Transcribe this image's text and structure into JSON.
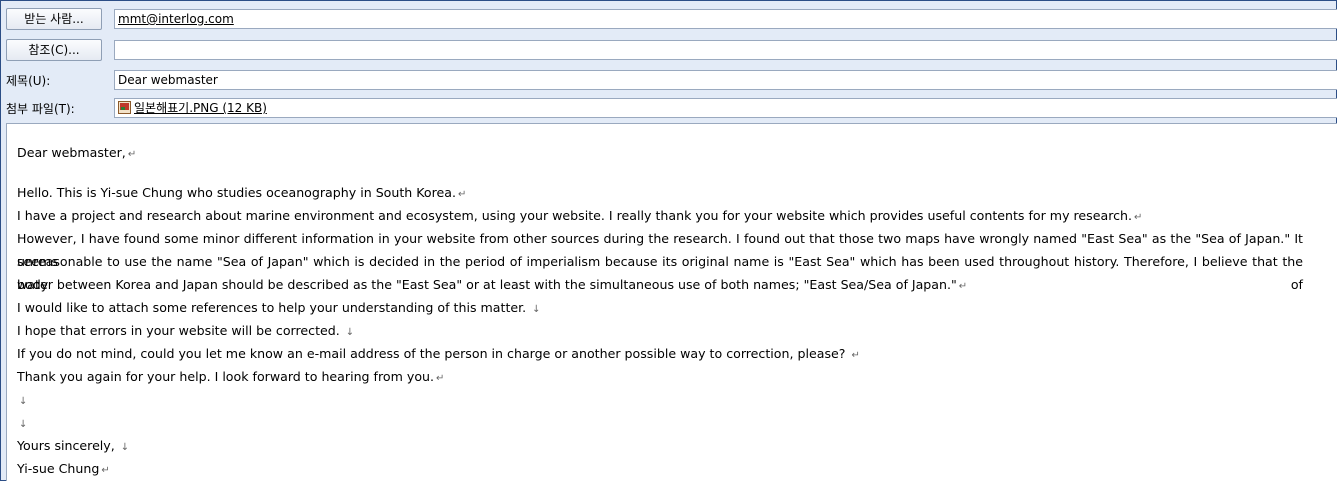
{
  "header": {
    "to_button": "받는 사람...",
    "to_value": "mmt@interlog.com",
    "cc_button": "참조(C)...",
    "cc_value": "",
    "subject_label": "제목(U):",
    "subject_value": "Dear webmaster",
    "attach_label": "첨부 파일(T):",
    "attach_name": "일본해표기.PNG (12 KB)"
  },
  "body": {
    "greeting": "Dear webmaster,",
    "line1": "Hello. This is Yi-sue Chung who studies oceanography in South Korea.",
    "line2": "I have a project and research about marine environment and ecosystem, using your website. I really thank you for your website which provides useful contents for my research.",
    "line3a": "However, I have found some minor different information in your website from other sources during the research. I found out that those two maps have wrongly named \"East Sea\" as the \"Sea of Japan.\" It seems",
    "line3b": "unreasonable to use the name \"Sea of Japan\" which is decided in the period of imperialism because its original name is \"East Sea\" which has been used throughout history. Therefore, I believe that the body of",
    "line3c": "water between Korea and Japan should be described as the \"East Sea\" or at least with the simultaneous use of both names; \"East Sea/Sea of Japan.\"",
    "line4": "I would like to attach some references to help your understanding of this matter.",
    "line5": "I hope that errors in your website will be corrected.",
    "line6": "If you do not mind, could you let me know an e-mail address of the person in charge or another possible way to correction, please?",
    "line7": "Thank you again for your help. I look forward to hearing from you.",
    "closing": "Yours sincerely,",
    "signature": "Yi-sue Chung",
    "para_mark": "↵",
    "break_mark": "↓"
  }
}
